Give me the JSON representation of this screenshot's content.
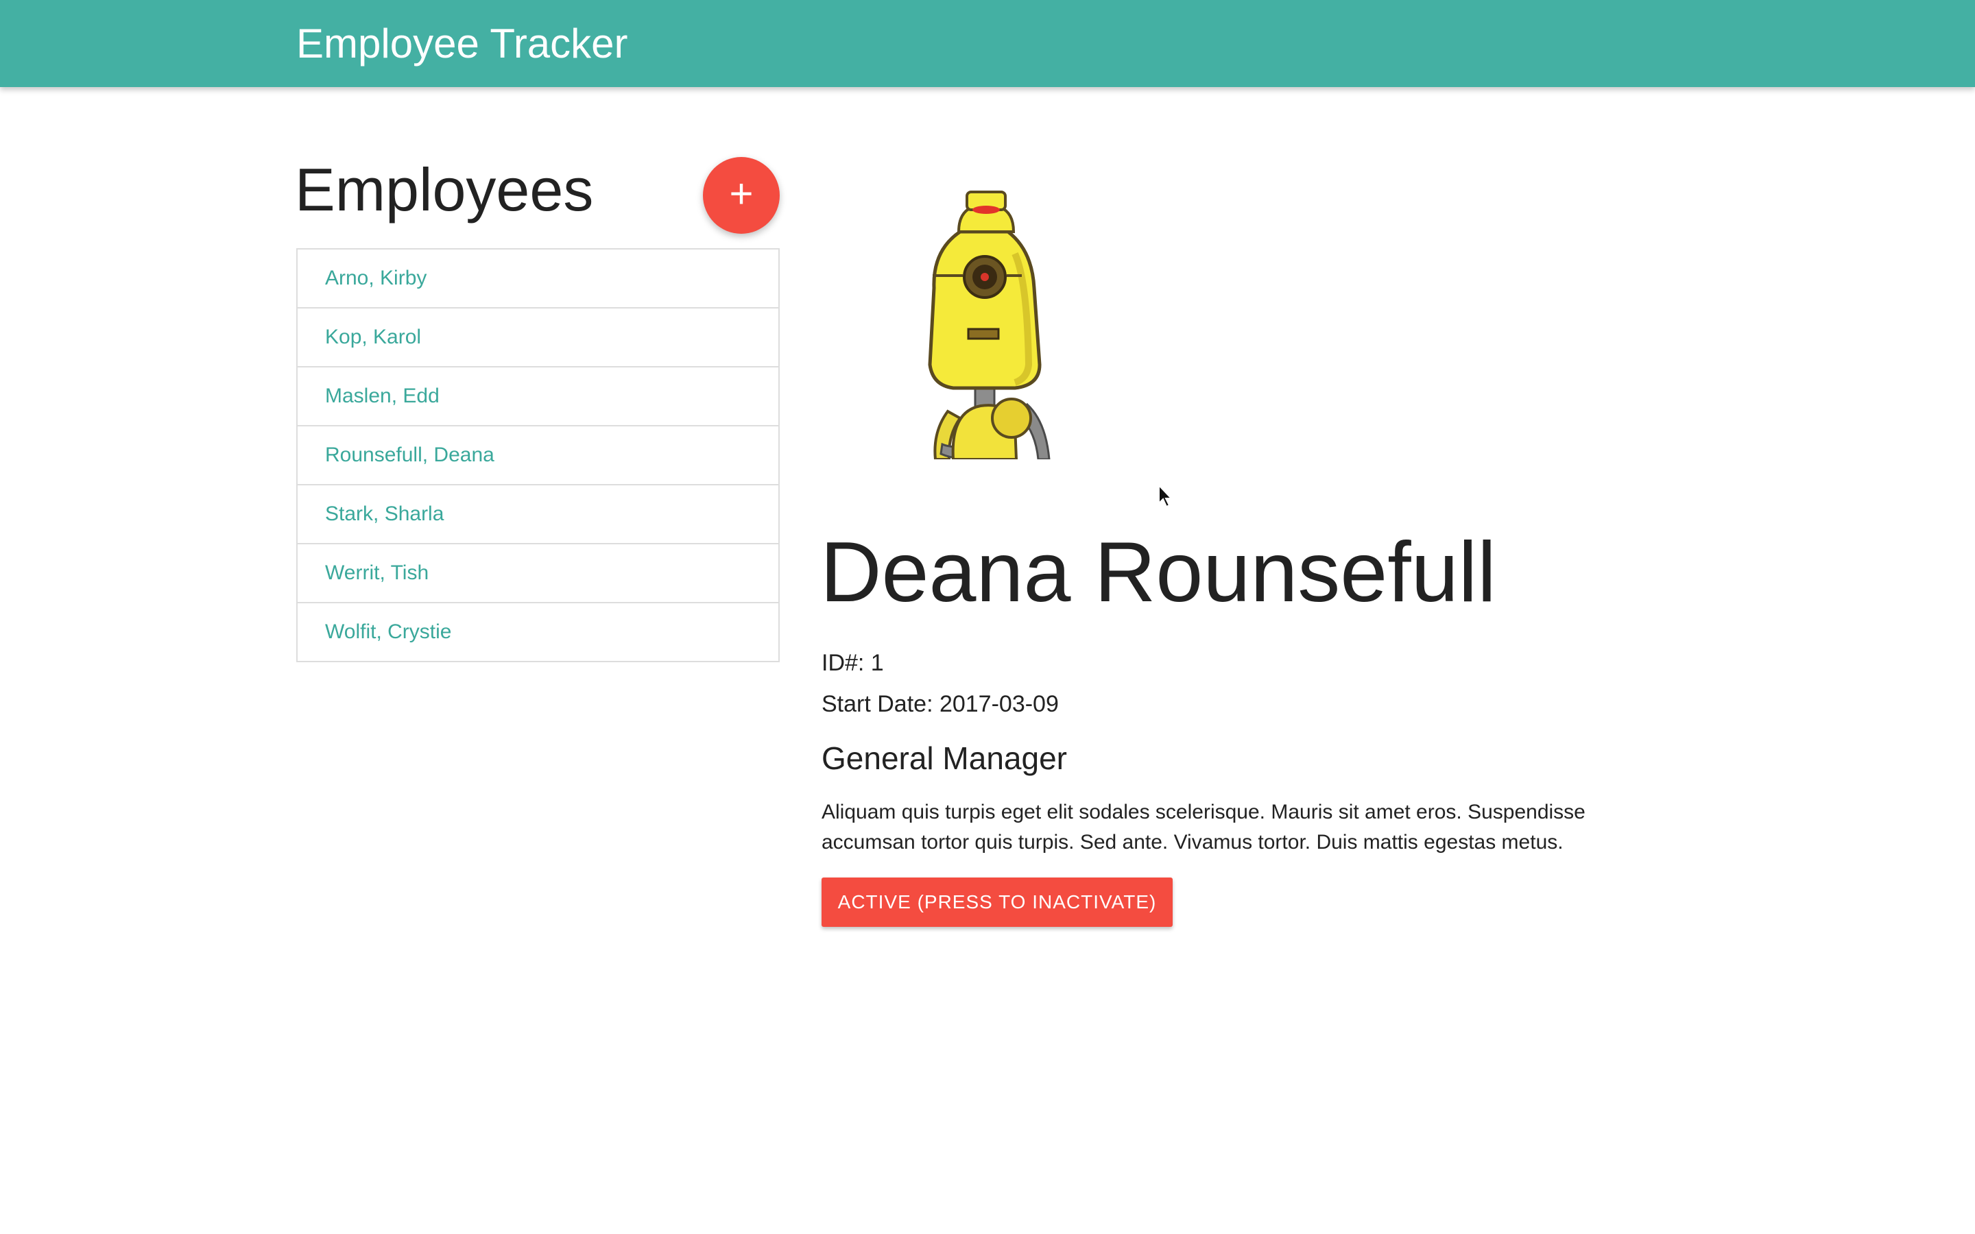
{
  "app": {
    "title": "Employee Tracker",
    "accent": "#44b0a3",
    "danger": "#f44c40"
  },
  "sidebar": {
    "heading": "Employees",
    "add_label": "+",
    "items": [
      {
        "label": "Arno, Kirby"
      },
      {
        "label": "Kop, Karol"
      },
      {
        "label": "Maslen, Edd"
      },
      {
        "label": "Rounsefull, Deana"
      },
      {
        "label": "Stark, Sharla"
      },
      {
        "label": "Werrit, Tish"
      },
      {
        "label": "Wolfit, Crystie"
      }
    ]
  },
  "detail": {
    "avatar_icon": "yellow-robot-avatar",
    "name": "Deana Rounsefull",
    "id_line": "ID#: 1",
    "start_date_line": "Start Date: 2017-03-09",
    "job_title": "General Manager",
    "description": "Aliquam quis turpis eget elit sodales scelerisque. Mauris sit amet eros. Suspendisse accumsan tortor quis turpis. Sed ante. Vivamus tortor. Duis mattis egestas metus.",
    "status_button": "ACTIVE (PRESS TO INACTIVATE)"
  }
}
